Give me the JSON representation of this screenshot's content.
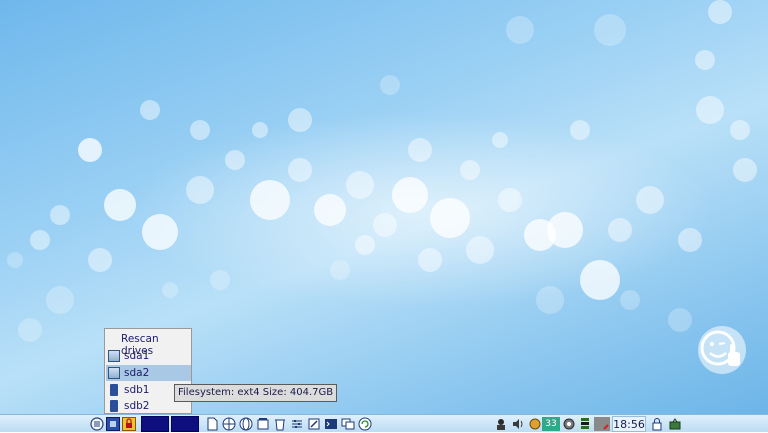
{
  "drive_menu": {
    "rescan_label": "Rescan drives",
    "drives": [
      {
        "label": "sda1",
        "icon": "hdd-icon",
        "selected": false
      },
      {
        "label": "sda2",
        "icon": "hdd-icon",
        "selected": true
      },
      {
        "label": "sdb1",
        "icon": "usb-drive-icon",
        "selected": false
      },
      {
        "label": "sdb2",
        "icon": "usb-drive-icon",
        "selected": false
      }
    ]
  },
  "tooltip": {
    "text": "Filesystem: ext4 Size: 404.7GB"
  },
  "taskbar": {
    "clock": "18:56",
    "cpu_temp": "33",
    "colors": {
      "bar": "#c9e5f7",
      "workspace": "#0e0e7e"
    }
  }
}
